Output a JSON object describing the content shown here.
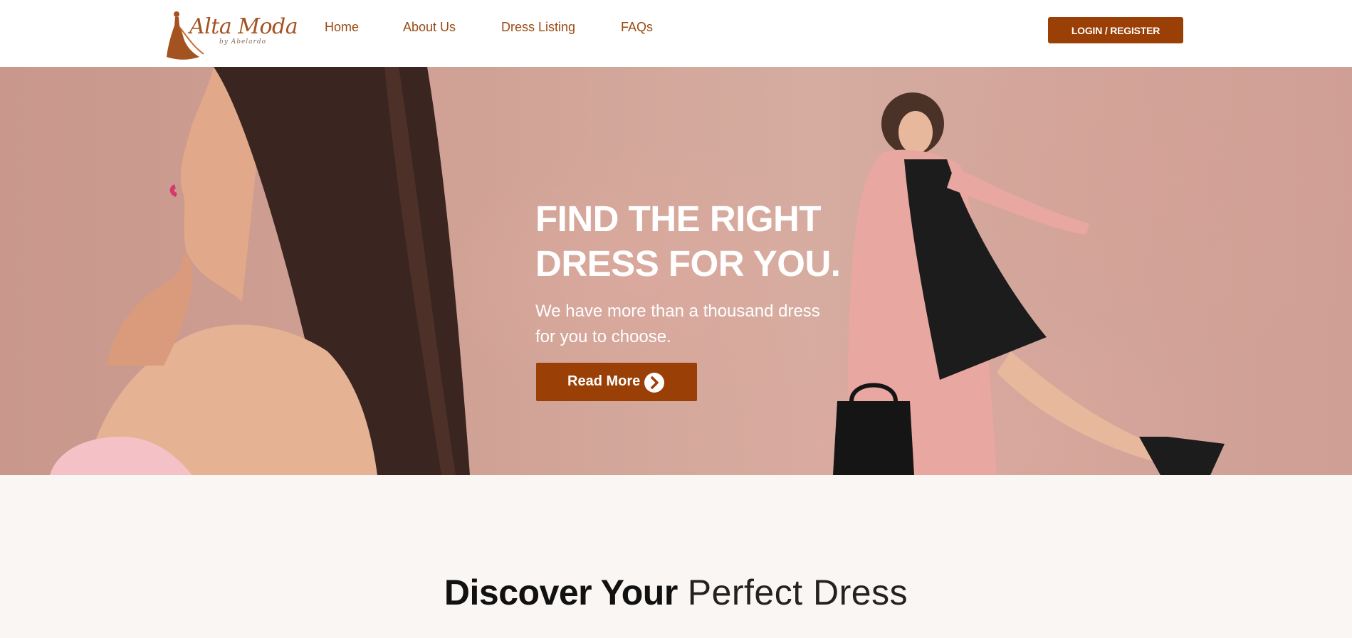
{
  "header": {
    "logo": {
      "title": "Alta Moda",
      "subtitle": "by Abelardo"
    },
    "nav": {
      "home": "Home",
      "about": "About Us",
      "dress_listing": "Dress Listing",
      "faqs": "FAQs"
    },
    "login_label": "LOGIN / REGISTER"
  },
  "hero": {
    "title_line1": "FIND THE RIGHT",
    "title_line2": "DRESS FOR YOU.",
    "subtitle_line1": "We have more than a thousand dress",
    "subtitle_line2": "for you to choose.",
    "cta_label": "Read More",
    "cta_icon": "chevron-right-circle-icon"
  },
  "discover": {
    "title_bold": "Discover Your",
    "title_light": "Perfect Dress"
  },
  "colors": {
    "accent": "#9a3f05",
    "nav_text": "#9a4a12",
    "hero_background": "#d0a295",
    "page_background": "#faf6f3"
  }
}
